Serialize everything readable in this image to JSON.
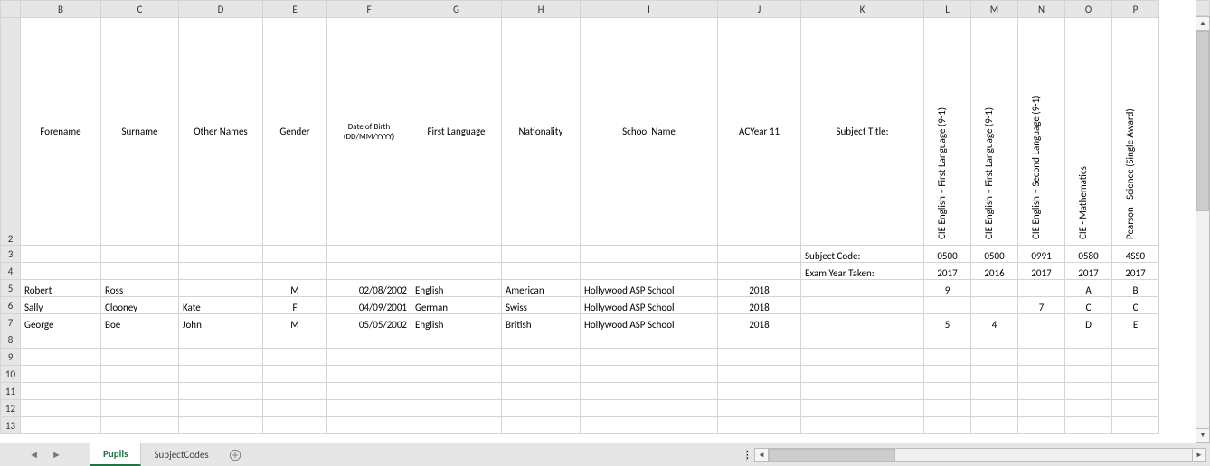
{
  "columns": [
    "B",
    "C",
    "D",
    "E",
    "F",
    "G",
    "H",
    "I",
    "J",
    "K",
    "L",
    "M",
    "N",
    "O",
    "P"
  ],
  "headers": {
    "B": "Forename",
    "C": "Surname",
    "D": "Other Names",
    "E": "Gender",
    "F": "Date of Birth (DD/MM/YYYY)",
    "G": "First Language",
    "H": "Nationality",
    "I": "School Name",
    "J": "ACYear 11",
    "K": "",
    "L": "CIE English – First Language (9-1)",
    "M": "CIE English – First Language (9-1)",
    "N": "CIE English – Second Language (9-1)",
    "O": "CIE - Mathematics",
    "P": "Pearson - Science (Single Award)"
  },
  "meta_rows": {
    "subject_title_label": "Subject Title:",
    "subject_code_label": "Subject Code:",
    "exam_year_label": "Exam Year Taken:",
    "codes": {
      "L": "0500",
      "M": "0500",
      "N": "0991",
      "O": "0580",
      "P": "4SS0"
    },
    "years": {
      "L": "2017",
      "M": "2016",
      "N": "2017",
      "O": "2017",
      "P": "2017"
    }
  },
  "rows": [
    {
      "n": "5",
      "B": "Robert",
      "C": "Ross",
      "D": "",
      "E": "M",
      "F": "02/08/2002",
      "G": "English",
      "H": "American",
      "I": "Hollywood ASP School",
      "J": "2018",
      "K": "",
      "L": "9",
      "M": "",
      "N": "",
      "O": "A",
      "P": "B"
    },
    {
      "n": "6",
      "B": "Sally",
      "C": "Clooney",
      "D": "Kate",
      "E": "F",
      "F": "04/09/2001",
      "G": "German",
      "H": "Swiss",
      "I": "Hollywood ASP School",
      "J": "2018",
      "K": "",
      "L": "",
      "M": "",
      "N": "7",
      "O": "C",
      "P": "C"
    },
    {
      "n": "7",
      "B": "George",
      "C": "Boe",
      "D": "John",
      "E": "M",
      "F": "05/05/2002",
      "G": "English",
      "H": "British",
      "I": "Hollywood ASP School",
      "J": "2018",
      "K": "",
      "L": "5",
      "M": "4",
      "N": "",
      "O": "D",
      "P": "E"
    }
  ],
  "empty_row_numbers": [
    "8",
    "9",
    "10",
    "11",
    "12",
    "13"
  ],
  "tabs": {
    "active": "Pupils",
    "others": [
      "SubjectCodes"
    ]
  }
}
